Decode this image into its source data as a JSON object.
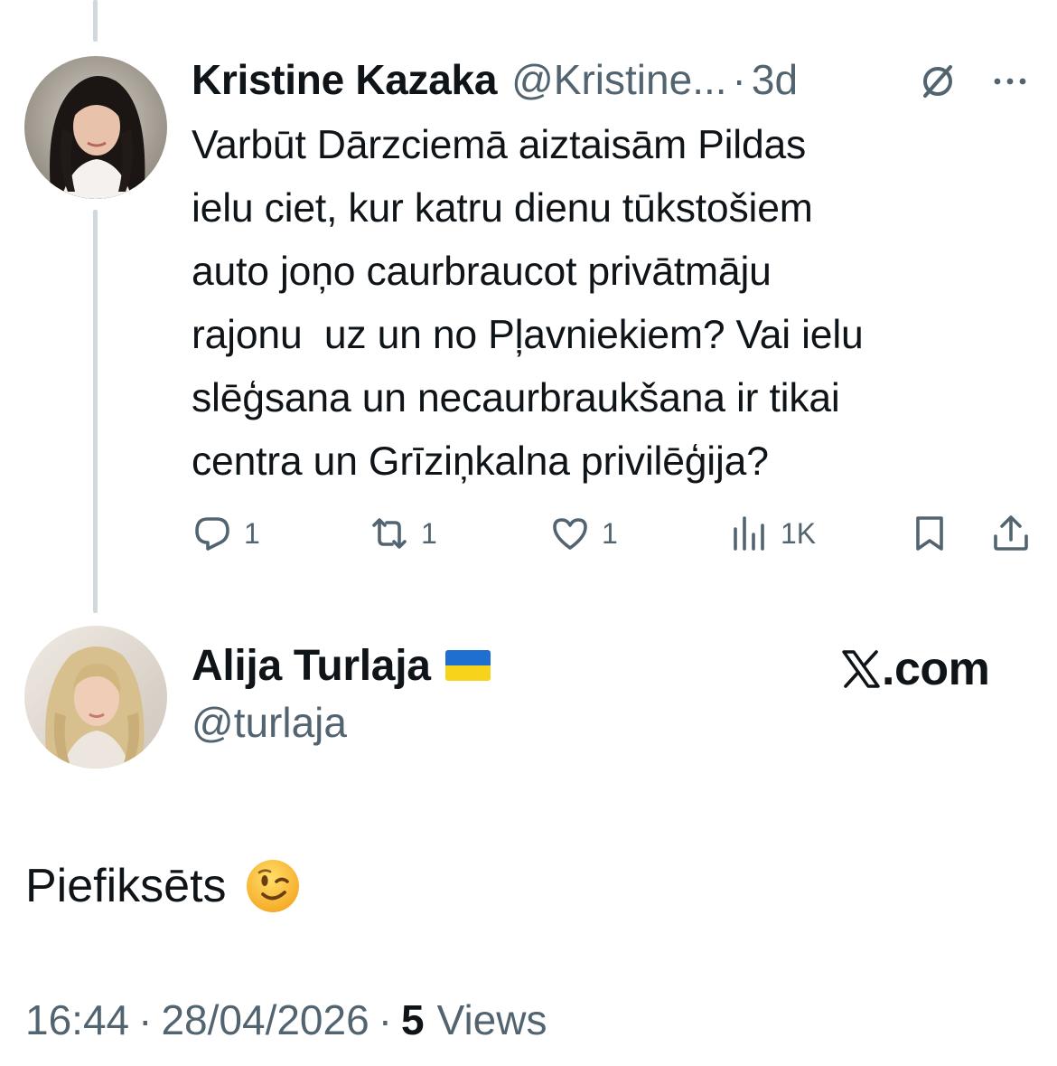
{
  "colors": {
    "text": "#0f1419",
    "muted": "#536471",
    "thread_line": "#cfd9de"
  },
  "original_tweet": {
    "display_name": "Kristine Kazaka",
    "handle": "@Kristine...",
    "separator": "·",
    "time": "3d",
    "text": "Varbūt Dārzciemā aiztaisām Pildas\nielu ciet, kur katru dienu tūkstošiem\nauto joņo caurbraucot privātmāju\nrajonu  uz un no Pļavniekiem? Vai ielu\nslēģsana un necaurbraukšana ir tikai\ncentra un Grīziņkalna privilēģija?",
    "actions": {
      "reply_count": "1",
      "repost_count": "1",
      "like_count": "1",
      "views_count": "1K"
    },
    "icons": [
      "grok-icon",
      "more-icon",
      "reply-icon",
      "repost-icon",
      "like-icon",
      "views-icon",
      "bookmark-icon",
      "share-icon"
    ]
  },
  "reply_tweet": {
    "display_name": "Alija Turlaja",
    "flag_emoji": "ukraine-flag",
    "handle": "@turlaja",
    "brand": ".com",
    "brand_icon": "x-logo-icon",
    "text": "Piefiksēts",
    "emoji": "winking-face",
    "timestamp": "16:44",
    "separator": "·",
    "date": "28/04/2026",
    "separator2": "·",
    "views_count": "5",
    "views_label": "Views"
  }
}
